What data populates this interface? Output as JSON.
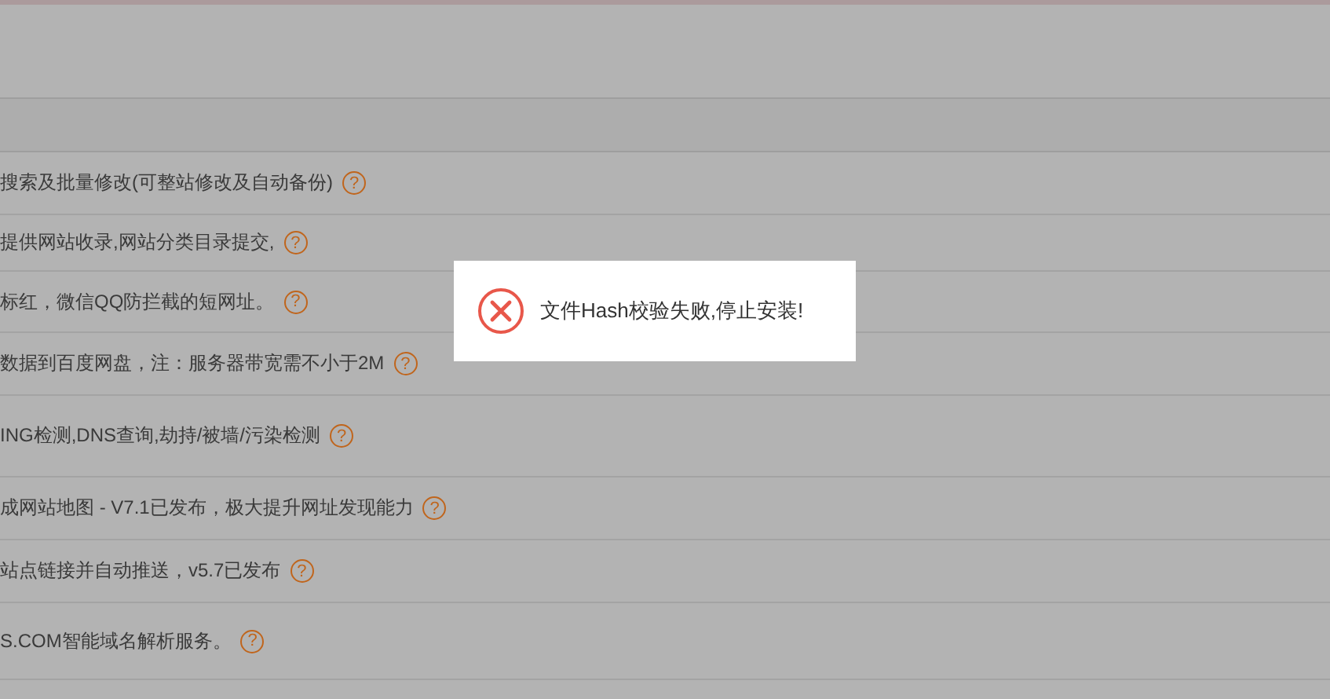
{
  "rows": [
    {
      "text": "搜索及批量修改(可整站修改及自动备份)",
      "help": "?"
    },
    {
      "text": "提供网站收录,网站分类目录提交,",
      "help": "?"
    },
    {
      "text": "标红，微信QQ防拦截的短网址。",
      "help": "?"
    },
    {
      "text": "数据到百度网盘，注：服务器带宽需不小于2M",
      "help": "?"
    },
    {
      "text": "ING检测,DNS查询,劫持/被墙/污染检测",
      "help": "?"
    },
    {
      "text": "成网站地图 - V7.1已发布，极大提升网址发现能力",
      "help": "?"
    },
    {
      "text": "站点链接并自动推送，v5.7已发布",
      "help": "?"
    },
    {
      "text": "S.COM智能域名解析服务。",
      "help": "?"
    }
  ],
  "dialog": {
    "kind": "error",
    "message": "文件Hash校验失败,停止安装!"
  }
}
